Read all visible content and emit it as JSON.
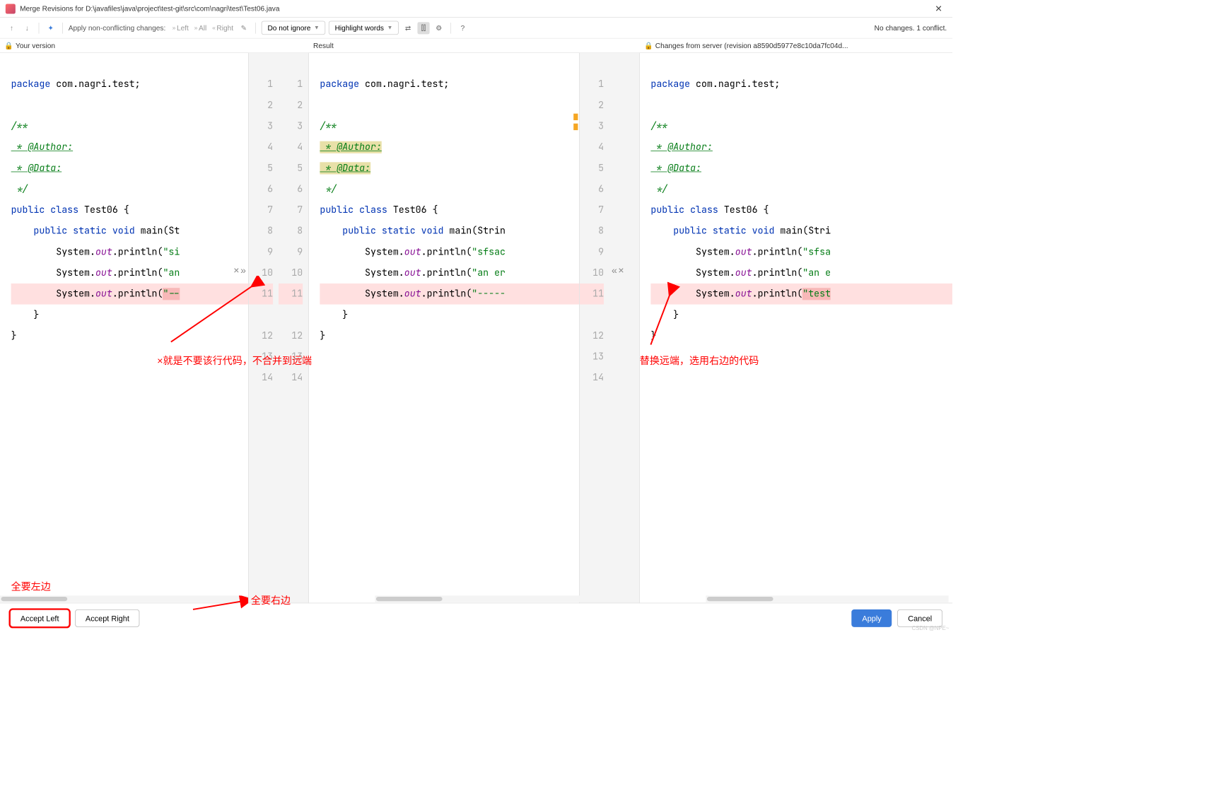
{
  "window": {
    "title": "Merge Revisions for D:\\javafiles\\java\\project\\test-git\\src\\com\\nagri\\test\\Test06.java"
  },
  "toolbar": {
    "apply_label": "Apply non-conflicting changes:",
    "left": "Left",
    "all": "All",
    "right": "Right",
    "ignore_select": "Do not ignore",
    "highlight_select": "Highlight words",
    "status": "No changes. 1 conflict."
  },
  "headers": {
    "left": "Your version",
    "center": "Result",
    "right": "Changes from server (revision a8590d5977e8c10da7fc04d..."
  },
  "line_numbers": [
    "1",
    "2",
    "3",
    "4",
    "5",
    "6",
    "7",
    "8",
    "9",
    "10",
    "11",
    "12",
    "13",
    "14"
  ],
  "code": {
    "package_kw": "package",
    "package_name": " com.nagri.test;",
    "doc_start": "/**",
    "doc_author": " * @Author:",
    "doc_data": " * @Data:",
    "doc_end": " */",
    "public_kw": "public",
    "class_kw": "class",
    "class_name": " Test06 {",
    "static_kw": "static",
    "void_kw": "void",
    "main_sig_left": " main(St",
    "main_sig_center": " main(Strin",
    "main_sig_right": " main(Stri",
    "sys": "System.",
    "out": "out",
    "println": ".println(",
    "str1_left": "\"si",
    "str1_center": "\"sfsac",
    "str1_right": "\"sfsa",
    "str2_left": "\"an",
    "str2_center": "\"an er",
    "str2_right": "\"an e",
    "str3_left": "\"--",
    "str3_center": "\"-----",
    "str3_right": "\"test",
    "brace_close": "}",
    "brace_close_indent": "    }"
  },
  "annotations": {
    "left_note": "×就是不要该行代码，不合并到远端",
    "right_note": "替换远端，选用右边的代码",
    "accept_left_note": "全要左边",
    "accept_right_note": "全要右边"
  },
  "footer": {
    "accept_left": "Accept Left",
    "accept_right": "Accept Right",
    "apply": "Apply",
    "cancel": "Cancel"
  },
  "watermark": "CSDN @NPE~"
}
